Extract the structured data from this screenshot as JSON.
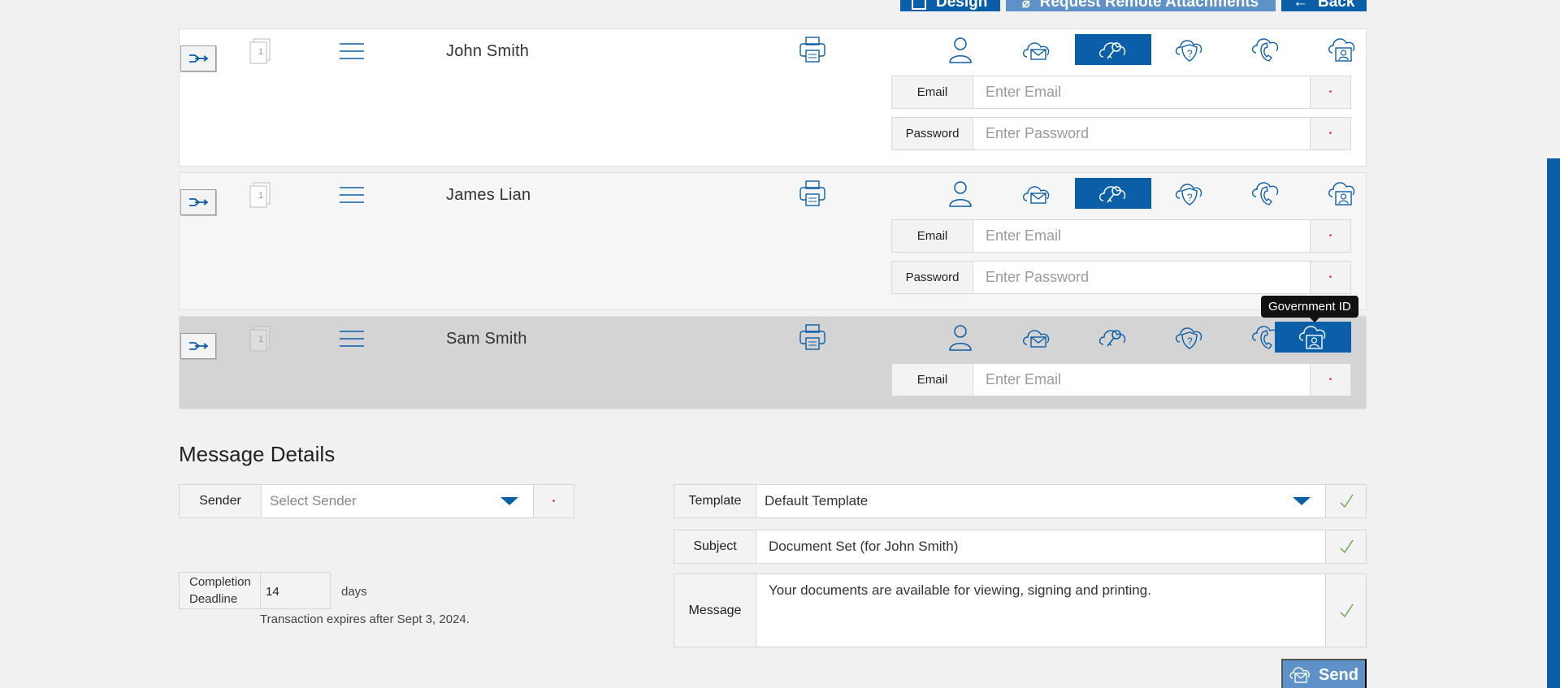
{
  "toolbar": {
    "design_label": "Design",
    "remote_label": "Request Remote Attachments",
    "back_label": "Back"
  },
  "recipients": [
    {
      "name": "John Smith",
      "active_auth": "sms-auth-icon",
      "fields": [
        {
          "label": "Email",
          "placeholder": "Enter Email"
        },
        {
          "label": "Password",
          "placeholder": "Enter Password"
        }
      ]
    },
    {
      "name": "James Lian",
      "active_auth": "sms-auth-icon",
      "fields": [
        {
          "label": "Email",
          "placeholder": "Enter Email"
        },
        {
          "label": "Password",
          "placeholder": "Enter Password"
        }
      ]
    },
    {
      "name": "Sam Smith",
      "active_auth": "government-id-icon",
      "fields": [
        {
          "label": "Email",
          "placeholder": "Enter Email"
        }
      ]
    }
  ],
  "doc_count": "1",
  "required_marker": "•",
  "tooltip": "Government ID",
  "message_details": {
    "title": "Message Details",
    "sender_label": "Sender",
    "sender_placeholder": "Select Sender",
    "template_label": "Template",
    "template_value": "Default Template",
    "subject_label": "Subject",
    "subject_value": "Document Set (for John Smith)",
    "message_label": "Message",
    "message_value": "Your documents are available for viewing, signing and printing.",
    "deadline_label": "Completion Deadline",
    "deadline_value": "14",
    "days_label": "days",
    "expires_text": "Transaction expires after Sept 3, 2024.",
    "send_label": "Send"
  },
  "colors": {
    "accent": "#0b5ea8",
    "accent_light": "#5d91c7",
    "check": "#6aa84f",
    "required": "#dd3333"
  }
}
